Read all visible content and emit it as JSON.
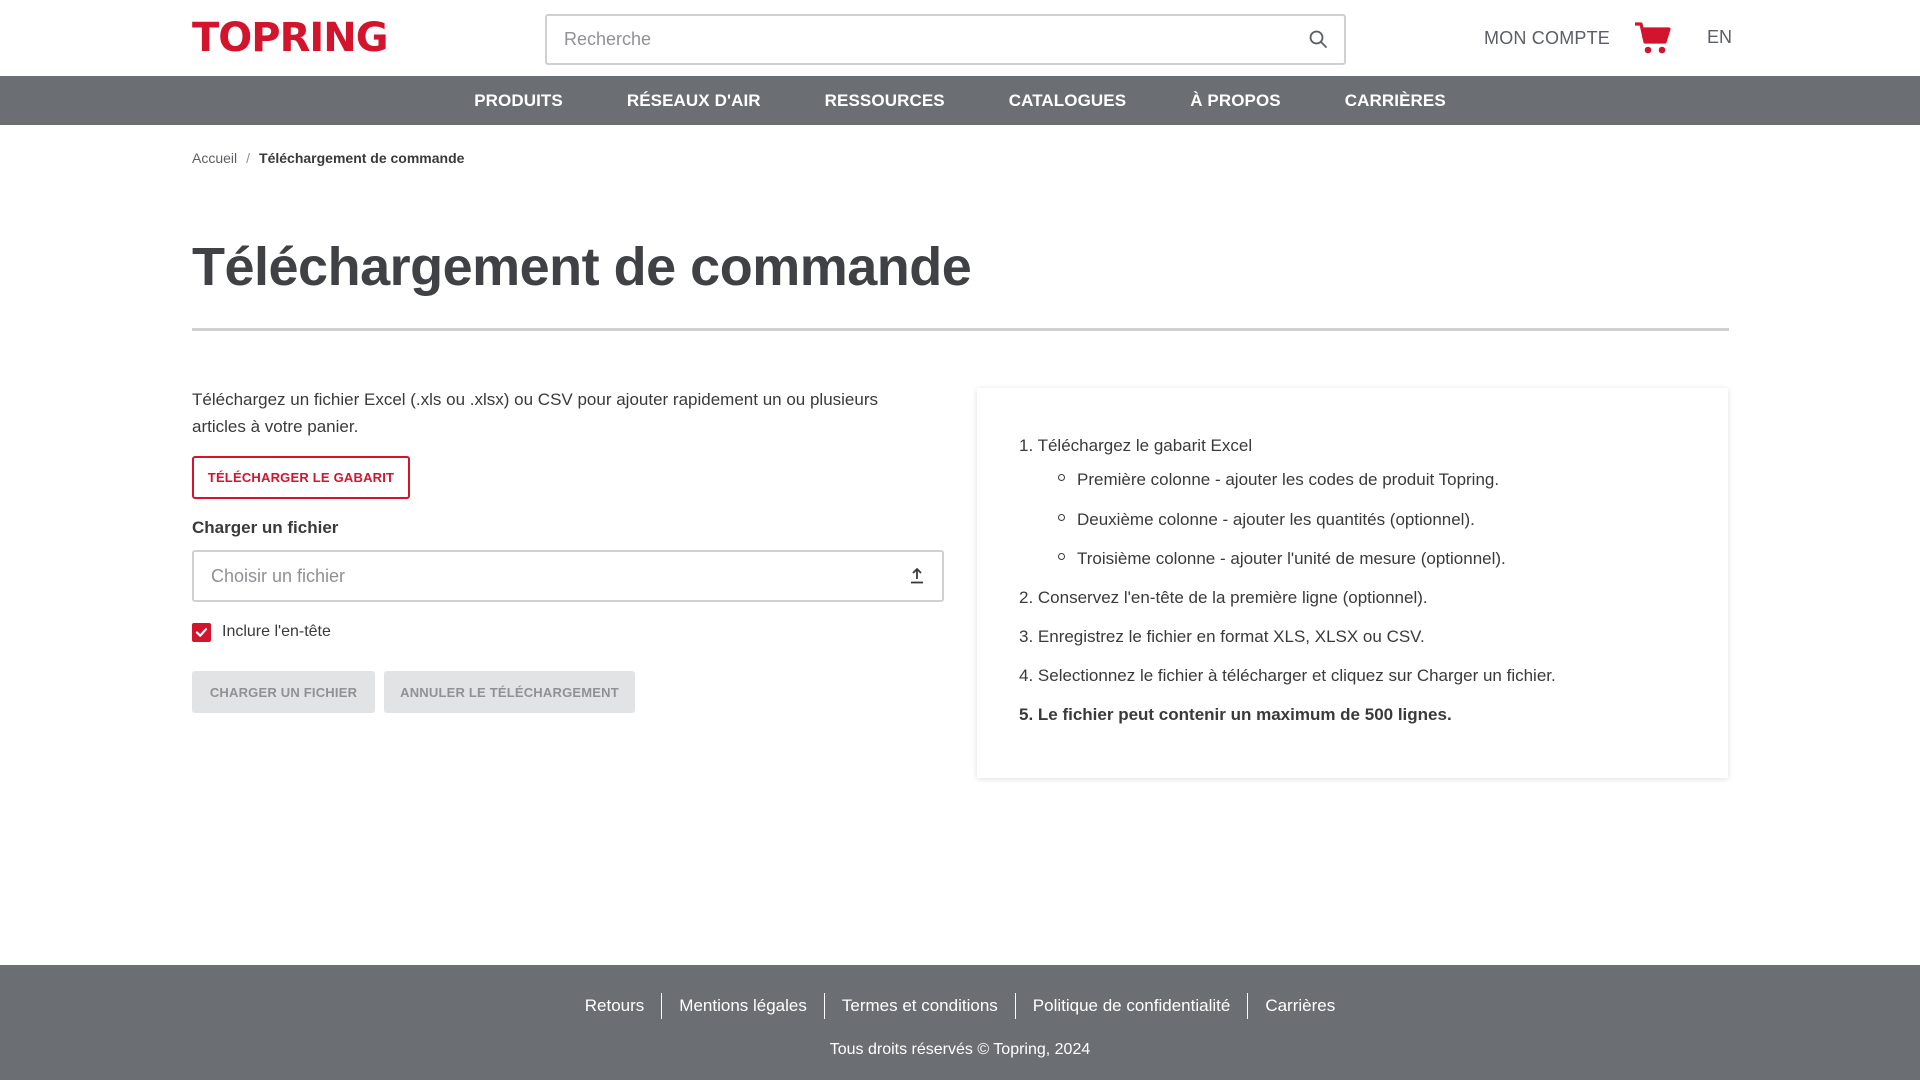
{
  "header": {
    "logo": "TOPRING",
    "search_placeholder": "Recherche",
    "account_label": "MON COMPTE",
    "cart_icon": "cart-icon",
    "language": "EN"
  },
  "nav": {
    "items": [
      "PRODUITS",
      "RÉSEAUX D'AIR",
      "RESSOURCES",
      "CATALOGUES",
      "À PROPOS",
      "CARRIÈRES"
    ]
  },
  "breadcrumb": {
    "home": "Accueil",
    "separator": "/",
    "current": "Téléchargement de commande"
  },
  "main": {
    "title": "Téléchargement de commande",
    "intro": "Téléchargez un fichier Excel (.xls ou .xlsx) ou CSV pour ajouter rapidement un ou plusieurs articles à votre panier.",
    "template_button": "TÉLÉCHARGER LE GABARIT",
    "upload_label": "Charger un fichier",
    "file_placeholder": "Choisir un fichier",
    "include_header_label": "Inclure l'en-tête",
    "include_header_checked": true,
    "upload_button": "CHARGER UN FICHIER",
    "cancel_button": "ANNULER LE TÉLÉCHARGEMENT"
  },
  "instructions": {
    "step1": "1. Téléchargez le gabarit Excel",
    "step1_sub": [
      "Première colonne - ajouter les codes de produit Topring.",
      "Deuxième colonne - ajouter les quantités (optionnel).",
      "Troisième colonne - ajouter l'unité de mesure (optionnel)."
    ],
    "step2": "2. Conservez l'en-tête de la première ligne (optionnel).",
    "step3": "3. Enregistrez le fichier en format XLS, XLSX ou CSV.",
    "step4": "4. Selectionnez le fichier à télécharger et cliquez sur Charger un fichier.",
    "step5": "5. Le fichier peut contenir un maximum de 500 lignes."
  },
  "footer": {
    "links": [
      "Retours",
      "Mentions légales",
      "Termes et conditions",
      "Politique de confidentialité",
      "Carrières"
    ],
    "copyright": "Tous droits réservés © Topring, 2024"
  },
  "colors": {
    "brand_red": "#d2142d",
    "nav_gray": "#6b6e73",
    "text": "#3a3a3a",
    "border": "#cfd0d2"
  }
}
